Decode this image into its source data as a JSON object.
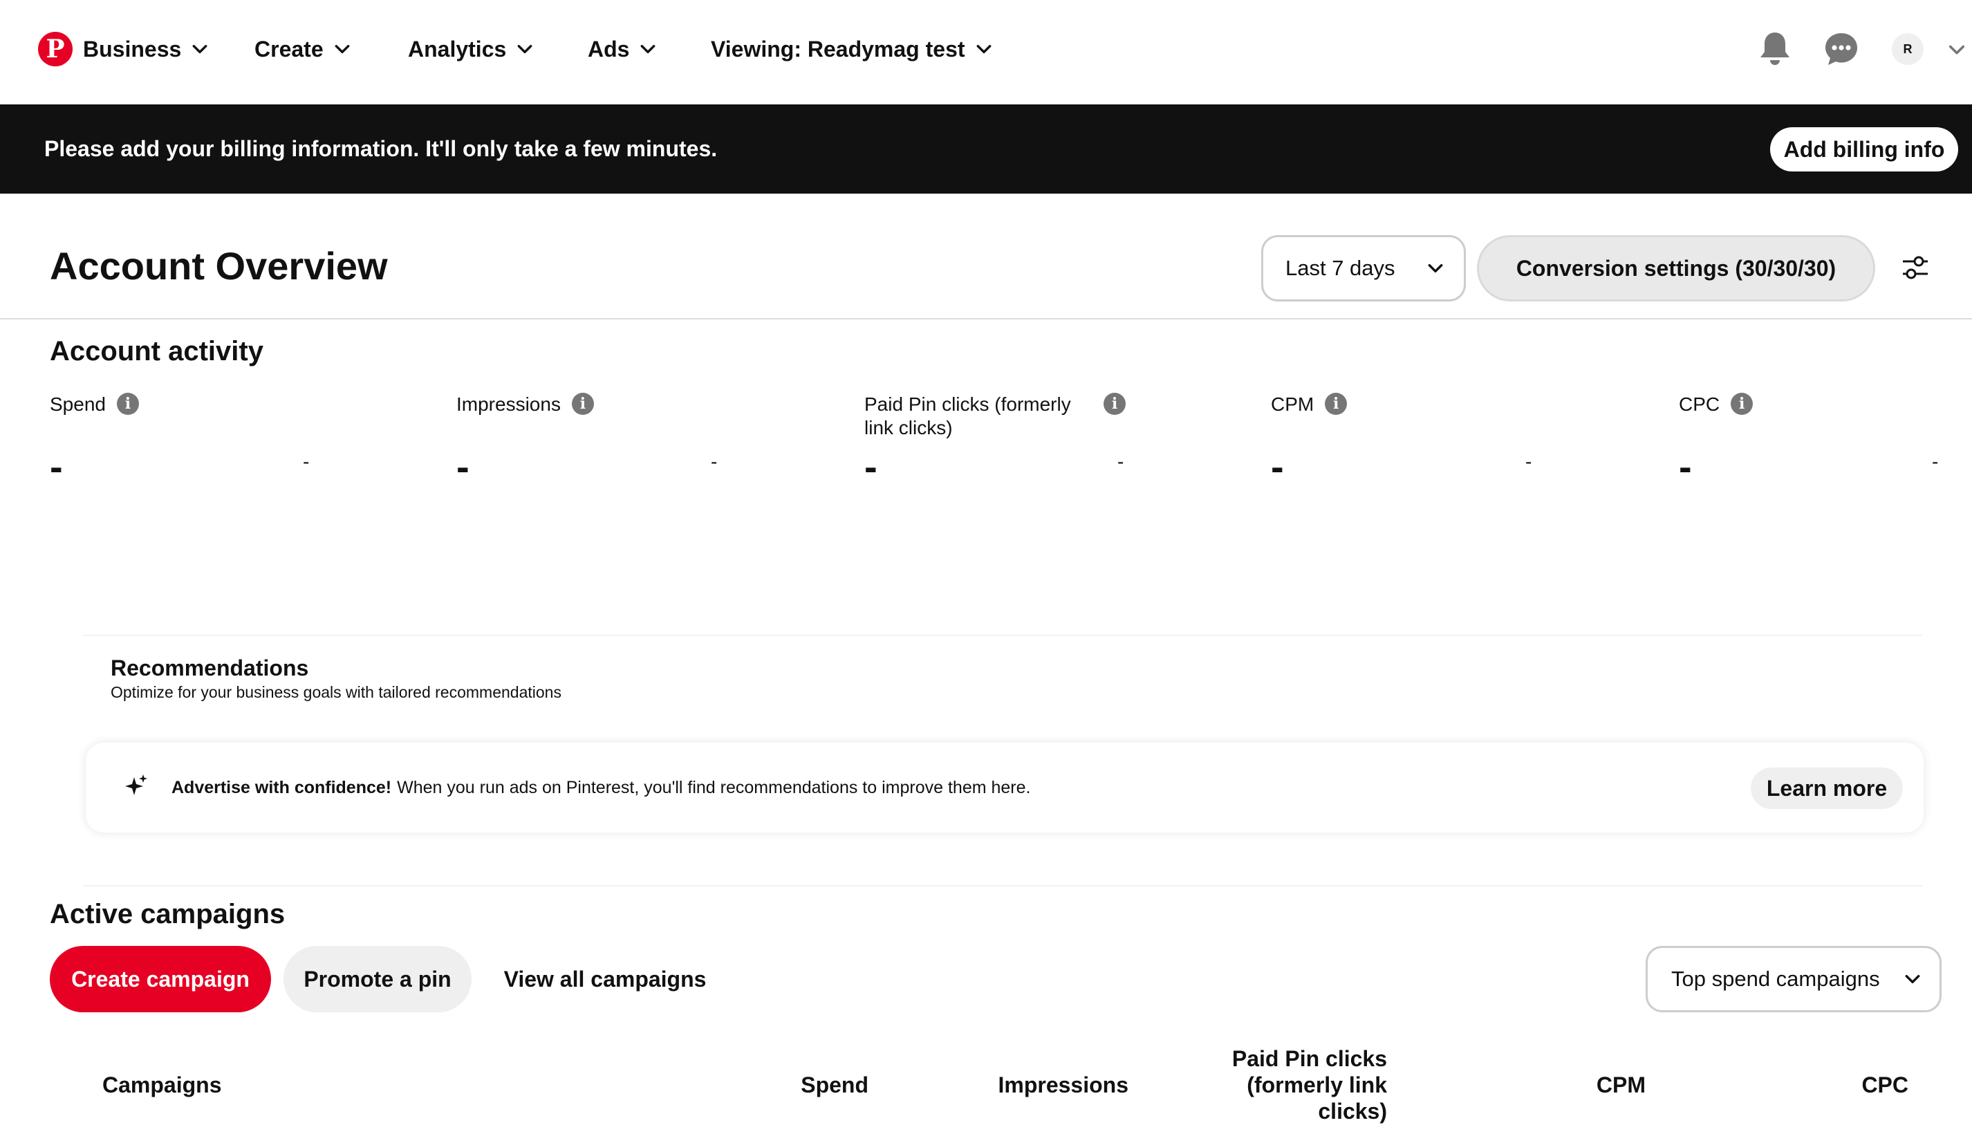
{
  "nav": {
    "logo_glyph": "P",
    "items": [
      {
        "label": "Business"
      },
      {
        "label": "Create"
      },
      {
        "label": "Analytics"
      },
      {
        "label": "Ads"
      },
      {
        "label": "Viewing: Readymag test"
      }
    ],
    "avatar_initial": "R",
    "icons": [
      "bell-icon",
      "messages-icon",
      "chevron-down-icon"
    ]
  },
  "banner": {
    "text": "Please add your billing information. It'll only take a few minutes.",
    "button_label": "Add billing info"
  },
  "header": {
    "title": "Account Overview",
    "date_range": "Last 7 days",
    "conversion_settings": "Conversion settings (30/30/30)"
  },
  "activity": {
    "title": "Account activity",
    "metrics": [
      {
        "label": "Spend",
        "value": "-",
        "change": "-"
      },
      {
        "label": "Impressions",
        "value": "-",
        "change": "-"
      },
      {
        "label": "Paid Pin clicks (formerly link clicks)",
        "value": "-",
        "change": "-"
      },
      {
        "label": "CPM",
        "value": "-",
        "change": "-"
      },
      {
        "label": "CPC",
        "value": "-",
        "change": "-"
      }
    ]
  },
  "recommendations": {
    "title": "Recommendations",
    "subtitle": "Optimize for your business goals with tailored recommendations",
    "card_bold": "Advertise with confidence!",
    "card_text": "When you run ads on Pinterest, you'll find recommendations to improve them here.",
    "learn_more": "Learn more"
  },
  "campaigns": {
    "title": "Active campaigns",
    "create_button": "Create campaign",
    "promote_button": "Promote a pin",
    "view_all": "View all campaigns",
    "sort_select": "Top spend campaigns",
    "columns": [
      "Campaigns",
      "Spend",
      "Impressions",
      "Paid Pin clicks (formerly link clicks)",
      "CPM",
      "CPC"
    ]
  },
  "colors": {
    "brand_red": "#e60023",
    "banner_bg": "#111111",
    "pill_gray": "#efefef"
  }
}
